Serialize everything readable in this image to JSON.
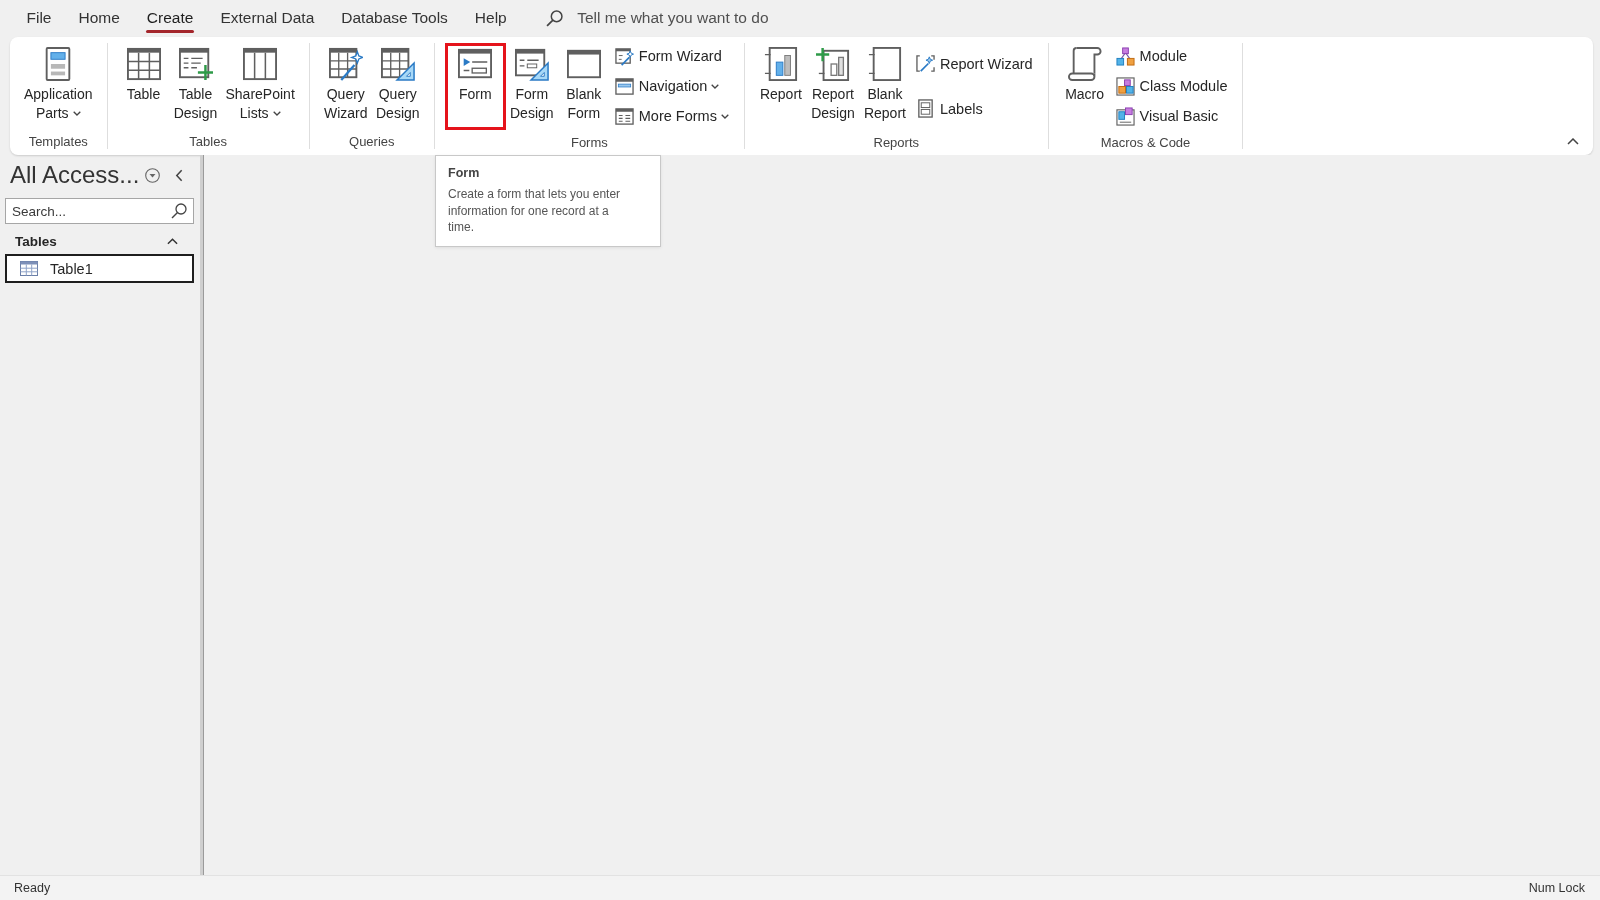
{
  "menu_tabs": [
    {
      "label": "File",
      "selected": false
    },
    {
      "label": "Home",
      "selected": false
    },
    {
      "label": "Create",
      "selected": true
    },
    {
      "label": "External Data",
      "selected": false
    },
    {
      "label": "Database Tools",
      "selected": false
    },
    {
      "label": "Help",
      "selected": false
    }
  ],
  "tell_me": {
    "placeholder": "Tell me what you want to do"
  },
  "ribbon": {
    "groups": [
      {
        "label": "Templates",
        "items": [
          {
            "kind": "large",
            "label": "Application Parts",
            "dropdown": true,
            "highlighted": false
          }
        ]
      },
      {
        "label": "Tables",
        "items": [
          {
            "kind": "large",
            "label": "Table",
            "dropdown": false,
            "highlighted": false
          },
          {
            "kind": "large",
            "label": "Table Design",
            "dropdown": false,
            "highlighted": false
          },
          {
            "kind": "large",
            "label": "SharePoint Lists",
            "dropdown": true,
            "highlighted": false
          }
        ]
      },
      {
        "label": "Queries",
        "items": [
          {
            "kind": "large",
            "label": "Query Wizard",
            "dropdown": false,
            "highlighted": false
          },
          {
            "kind": "large",
            "label": "Query Design",
            "dropdown": false,
            "highlighted": false
          }
        ]
      },
      {
        "label": "Forms",
        "items": [
          {
            "kind": "large",
            "label": "Form",
            "dropdown": false,
            "highlighted": true
          },
          {
            "kind": "large",
            "label": "Form Design",
            "dropdown": false,
            "highlighted": false
          },
          {
            "kind": "large",
            "label": "Blank Form",
            "dropdown": false,
            "highlighted": false
          },
          {
            "kind": "stack",
            "items": [
              {
                "label": "Form Wizard",
                "dropdown": false,
                "highlighted": false
              },
              {
                "label": "Navigation",
                "dropdown": true,
                "highlighted": false
              },
              {
                "label": "More Forms",
                "dropdown": true,
                "highlighted": false
              }
            ]
          }
        ]
      },
      {
        "label": "Reports",
        "items": [
          {
            "kind": "large",
            "label": "Report",
            "dropdown": false,
            "highlighted": false
          },
          {
            "kind": "large",
            "label": "Report Design",
            "dropdown": false,
            "highlighted": false
          },
          {
            "kind": "large",
            "label": "Blank Report",
            "dropdown": false,
            "highlighted": false
          },
          {
            "kind": "stack",
            "items": [
              {
                "label": "Report Wizard",
                "dropdown": false,
                "highlighted": false
              },
              {
                "label": "Labels",
                "dropdown": false,
                "highlighted": false
              }
            ]
          }
        ]
      },
      {
        "label": "Macros & Code",
        "items": [
          {
            "kind": "large",
            "label": "Macro",
            "dropdown": false,
            "highlighted": false
          },
          {
            "kind": "stack",
            "items": [
              {
                "label": "Module",
                "dropdown": false,
                "highlighted": false
              },
              {
                "label": "Class Module",
                "dropdown": false,
                "highlighted": false
              },
              {
                "label": "Visual Basic",
                "dropdown": false,
                "highlighted": false
              }
            ]
          }
        ]
      }
    ]
  },
  "tooltip": {
    "title": "Form",
    "text": "Create a form that lets you enter information for one record at a time."
  },
  "navigation_pane": {
    "title": "All Access...",
    "search": {
      "placeholder": "Search..."
    },
    "groups": [
      {
        "label": "Tables",
        "expanded": true,
        "items": [
          {
            "label": "Table1",
            "selected": true
          }
        ]
      }
    ]
  },
  "status_bar": {
    "left": "Ready",
    "right": "Num Lock"
  }
}
